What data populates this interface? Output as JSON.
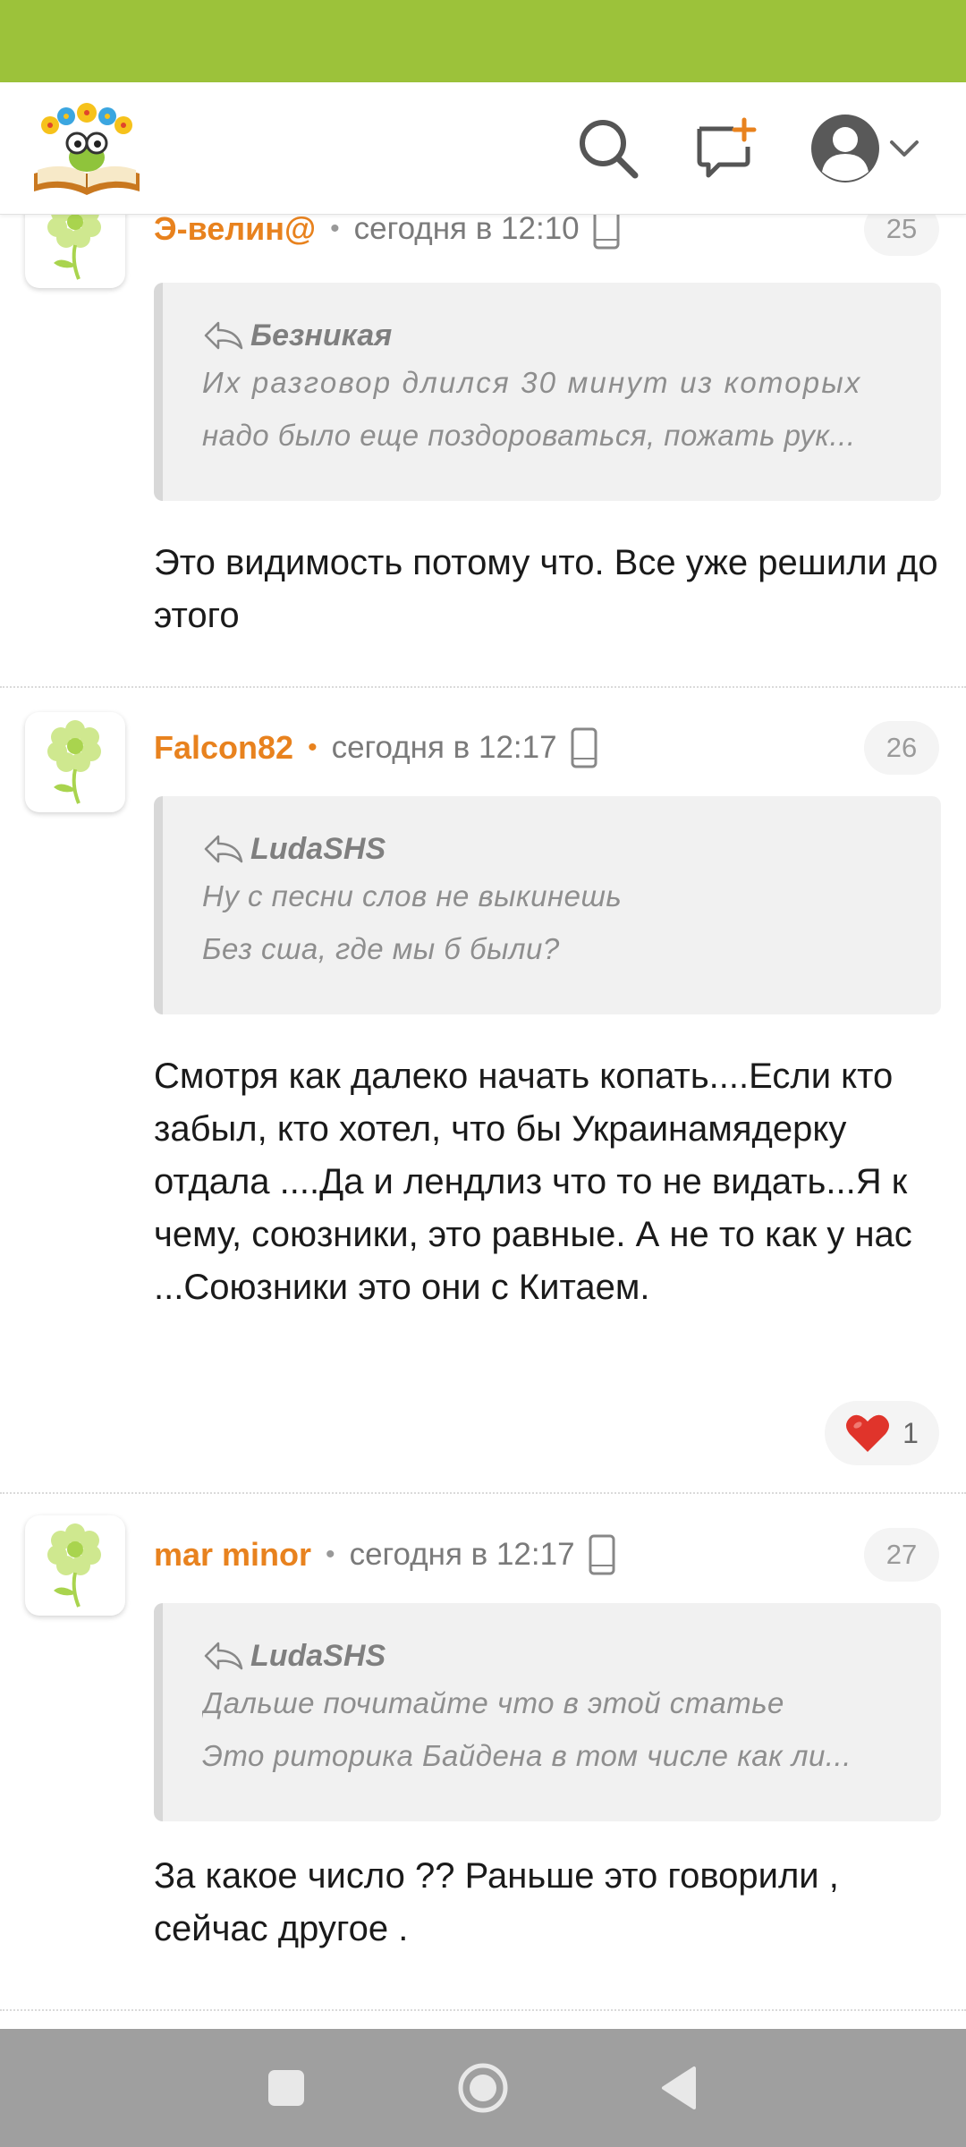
{
  "colors": {
    "status_bar": "#9cc23a",
    "accent": "#e8821e",
    "nav_bar": "#9f9f9f"
  },
  "header": {
    "icons": [
      "logo-book-flower",
      "search-icon",
      "new-message-icon",
      "avatar-icon",
      "chevron-down-icon"
    ]
  },
  "comments": [
    {
      "author": "Э-велин@",
      "timestamp": "сегодня в 12:10",
      "number": "25",
      "quote_author": "Безникая",
      "quote_lines": [
        "Их разговор длился 30 минут из которых",
        "надо было еще поздороваться, пожать рук..."
      ],
      "body": "Это видимость потому что. Все уже решили до этого"
    },
    {
      "author": "Falcon82",
      "timestamp": "сегодня в 12:17",
      "number": "26",
      "quote_author": "LudaSHS",
      "quote_lines": [
        "Ну с песни слов не выкинешь",
        "Без сша, где мы б были?"
      ],
      "body": "Смотря как далеко начать копать....Если кто забыл, кто хотел, что бы Украинамядерку отдала ....Да и лендлиз что то не видать...Я к чему, союзники, это равные. А не то как у нас ...Союзники это они с Китаем.",
      "likes": "1"
    },
    {
      "author": "mar minor",
      "timestamp": "сегодня в 12:17",
      "number": "27",
      "quote_author": "LudaSHS",
      "quote_lines": [
        "Дальше почитайте что в этой статье",
        "Это риторика Байдена в том числе как ли..."
      ],
      "body": "За какое число ?? Раньше это говорили , сейчас другое ."
    }
  ],
  "nav": {
    "icons": [
      "recent-apps-icon",
      "home-icon",
      "back-icon"
    ]
  }
}
